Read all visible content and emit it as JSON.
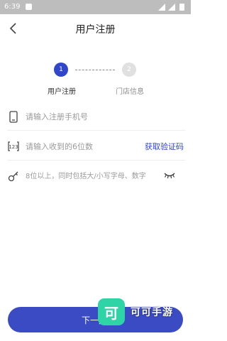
{
  "status_bar": {
    "time": "6:39"
  },
  "header": {
    "title": "用户注册"
  },
  "steps": [
    {
      "number": "1",
      "label": "用户注册",
      "active": true
    },
    {
      "number": "2",
      "label": "门店信息",
      "active": false
    }
  ],
  "form": {
    "phone": {
      "placeholder": "请输入注册手机号",
      "value": ""
    },
    "code": {
      "placeholder": "请输入收到的6位数",
      "value": "",
      "get_code_label": "获取验证码"
    },
    "password": {
      "placeholder": "8位以上，同时包括大/小写字母、数字",
      "value": ""
    }
  },
  "footer": {
    "next_label": "下一步"
  },
  "watermark": {
    "logo_text": "可",
    "brand": "可可手游"
  },
  "colors": {
    "accent": "#3147c9",
    "step_inactive": "#e0e0e0",
    "button": "#3a4bc4",
    "watermark_logo": "#2ed3a6"
  },
  "icons": {
    "back": "chevron-left-icon",
    "phone": "phone-icon",
    "code": "code-123-icon",
    "password": "key-icon",
    "visibility": "eye-closed-icon"
  }
}
